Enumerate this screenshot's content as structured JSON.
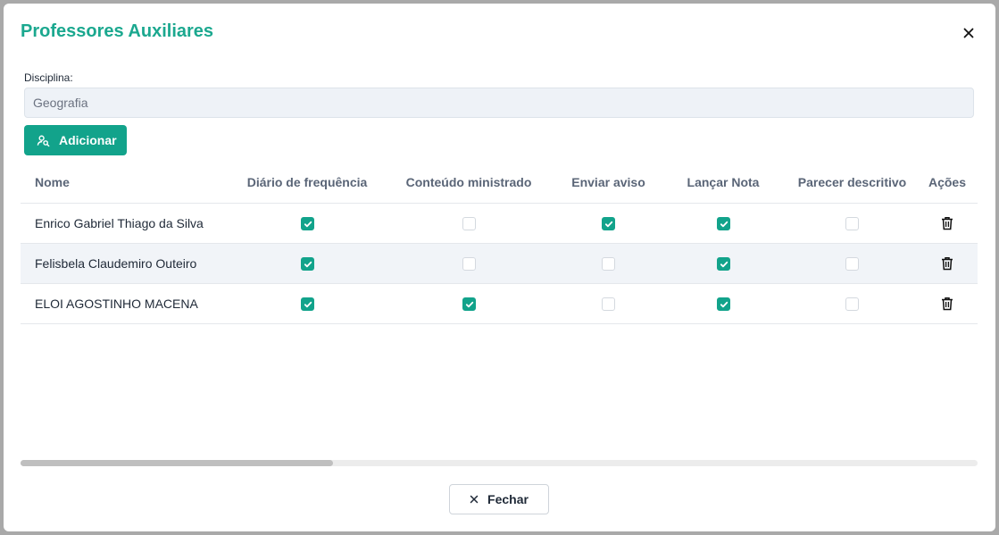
{
  "modal": {
    "title": "Professores Auxiliares",
    "close_icon": "close-icon"
  },
  "field": {
    "label": "Disciplina:",
    "value": "Geografia"
  },
  "add_button": {
    "label": "Adicionar",
    "icon": "user-search-icon"
  },
  "table": {
    "columns": [
      "Nome",
      "Diário de frequência",
      "Conteúdo ministrado",
      "Enviar aviso",
      "Lançar Nota",
      "Parecer descritivo",
      "Ações"
    ],
    "rows": [
      {
        "name": "Enrico Gabriel Thiago da Silva",
        "checks": [
          true,
          false,
          true,
          true,
          false
        ]
      },
      {
        "name": "Felisbela Claudemiro Outeiro",
        "checks": [
          true,
          false,
          false,
          true,
          false
        ]
      },
      {
        "name": "ELOI AGOSTINHO MACENA",
        "checks": [
          true,
          true,
          false,
          true,
          false
        ]
      }
    ],
    "action_icon": "trash-icon"
  },
  "footer": {
    "close_label": "Fechar",
    "close_icon": "close-icon"
  },
  "colors": {
    "accent": "#12a38b",
    "title": "#1ba88f"
  }
}
